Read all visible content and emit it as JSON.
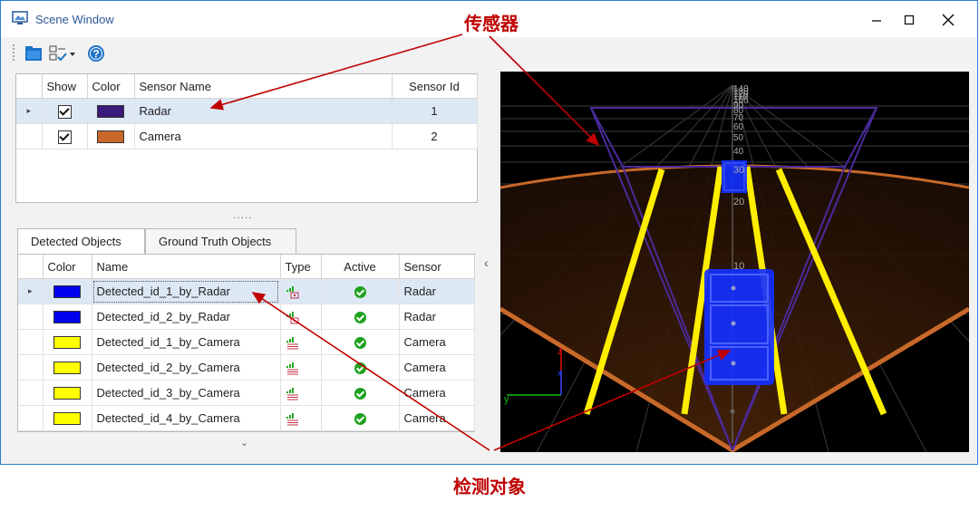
{
  "window": {
    "title": "Scene Window",
    "controls": {
      "minimize": "—",
      "maximize": "☐",
      "close": "✕"
    }
  },
  "toolbar": {
    "icons": [
      "open-folder-icon",
      "checklist-dropdown-icon",
      "help-icon"
    ]
  },
  "sensors": {
    "columns": [
      "Show",
      "Color",
      "Sensor Name",
      "Sensor Id"
    ],
    "rows": [
      {
        "show": true,
        "color": "#3a1a7a",
        "name": "Radar",
        "id": "1",
        "selected": true
      },
      {
        "show": true,
        "color": "#c8692a",
        "name": "Camera",
        "id": "2",
        "selected": false
      }
    ]
  },
  "splitter": {
    "grip": "....."
  },
  "tabs": [
    {
      "label": "Detected Objects",
      "active": true
    },
    {
      "label": "Ground Truth Objects",
      "active": false
    }
  ],
  "objects": {
    "columns": [
      "Color",
      "Name",
      "Type",
      "Active",
      "Sensor"
    ],
    "rows": [
      {
        "color": "#0000ee",
        "name": "Detected_id_1_by_Radar",
        "type": "radar",
        "active": true,
        "sensor": "Radar",
        "selected": true
      },
      {
        "color": "#0000ee",
        "name": "Detected_id_2_by_Radar",
        "type": "radar",
        "active": true,
        "sensor": "Radar",
        "selected": false
      },
      {
        "color": "#ffff00",
        "name": "Detected_id_1_by_Camera",
        "type": "camera",
        "active": true,
        "sensor": "Camera",
        "selected": false
      },
      {
        "color": "#ffff00",
        "name": "Detected_id_2_by_Camera",
        "type": "camera",
        "active": true,
        "sensor": "Camera",
        "selected": false
      },
      {
        "color": "#ffff00",
        "name": "Detected_id_3_by_Camera",
        "type": "camera",
        "active": true,
        "sensor": "Camera",
        "selected": false
      },
      {
        "color": "#ffff00",
        "name": "Detected_id_4_by_Camera",
        "type": "camera",
        "active": true,
        "sensor": "Camera",
        "selected": false
      }
    ]
  },
  "scene": {
    "distance_labels": [
      "10",
      "20",
      "30",
      "40",
      "50",
      "60",
      "70",
      "80",
      "90",
      "100",
      "110",
      "120",
      "130",
      "140"
    ],
    "axis_labels": {
      "x": "x",
      "y": "y"
    }
  },
  "annotations": {
    "sensor_label": "传感器",
    "objects_label": "检测对象"
  },
  "colors": {
    "accent": "#2b7cd3",
    "annotation": "#c00000",
    "radar": "#3a1a7a",
    "camera": "#c8692a"
  }
}
